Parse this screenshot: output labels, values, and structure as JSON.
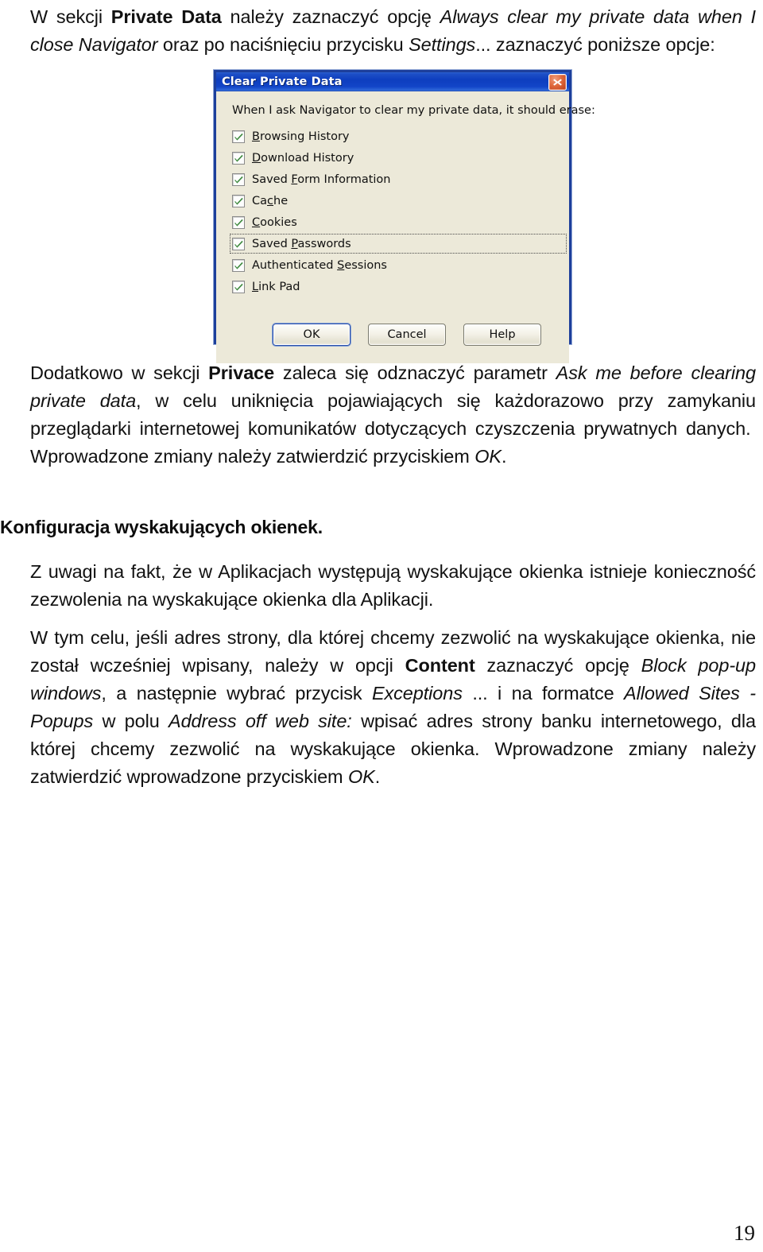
{
  "page": {
    "number": "19"
  },
  "paragraphs": {
    "intro": "W sekcji Private Data należy zaznaczyć opcję Always clear my private data when I close Navigator oraz po naciśnięciu przycisku Settings... zaznaczyć poniższe opcje:",
    "after_dialog": "Dodatkowo w sekcji Privace zaleca się odznaczyć parametr Ask me before clearing private data, w celu uniknięcia pojawiających się każdorazowo przy zamykaniu przeglądarki internetowej komunikatów dotyczących czyszczenia prywatnych danych.  Wprowadzone zmiany należy zatwierdzić przyciskiem OK.",
    "popup_intro": "Z uwagi na fakt, że w Aplikacjach występują wyskakujące okienka istnieje konieczność zezwolenia na wyskakujące okienka dla Aplikacji.",
    "popup_steps": "W tym celu, jeśli adres strony, dla której chcemy zezwolić na wyskakujące okienka, nie został wcześniej wpisany, należy w opcji Content zaznaczyć opcję Block pop-up windows, a następnie wybrać przycisk Exceptions ... i na formatce Allowed Sites - Popups w polu Address off web site: wpisać adres strony banku internetowego, dla której chcemy zezwolić na wyskakujące okienka. Wprowadzone zmiany należy zatwierdzić wprowadzone przyciskiem OK."
  },
  "headings": {
    "popup_config": "Konfiguracja wyskakujących okienek."
  },
  "inline_terms": {
    "private_data": "Private Data",
    "always_clear": "Always clear my private data when I close Navigator",
    "settings": "Settings",
    "settings_ellipsis": "...",
    "privace": "Privace",
    "ask_me_before": "Ask me before clearing private data",
    "ok": "OK",
    "content": "Content",
    "block_popups": "Block pop-up windows",
    "exceptions": "Exceptions",
    "allowed_sites": "Allowed Sites - Popups",
    "address_off_web_site": "Address off web site:"
  },
  "dialog": {
    "title": "Clear Private Data",
    "close_tooltip": "Close",
    "prompt": "When I ask Navigator to clear my private data, it should erase:",
    "checkboxes": [
      {
        "label_before": "",
        "accel": "B",
        "label_after": "rowsing History",
        "checked": true,
        "focused": false
      },
      {
        "label_before": "",
        "accel": "D",
        "label_after": "ownload History",
        "checked": true,
        "focused": false
      },
      {
        "label_before": "Saved ",
        "accel": "F",
        "label_after": "orm Information",
        "checked": true,
        "focused": false
      },
      {
        "label_before": "Ca",
        "accel": "c",
        "label_after": "he",
        "checked": true,
        "focused": false
      },
      {
        "label_before": "",
        "accel": "C",
        "label_after": "ookies",
        "checked": true,
        "focused": false
      },
      {
        "label_before": "Saved ",
        "accel": "P",
        "label_after": "asswords",
        "checked": true,
        "focused": true
      },
      {
        "label_before": "Authenticated ",
        "accel": "S",
        "label_after": "essions",
        "checked": true,
        "focused": false
      },
      {
        "label_before": "",
        "accel": "L",
        "label_after": "ink Pad",
        "checked": true,
        "focused": false
      }
    ],
    "buttons": [
      {
        "label": "OK",
        "default": true
      },
      {
        "label": "Cancel",
        "default": false
      },
      {
        "label": "Help",
        "default": false
      }
    ],
    "colors": {
      "titlebar": "#0b3ec6",
      "face": "#ece9d8",
      "border": "#1b3fa0",
      "check": "#2f7a2f",
      "close": "#c8441a"
    }
  }
}
